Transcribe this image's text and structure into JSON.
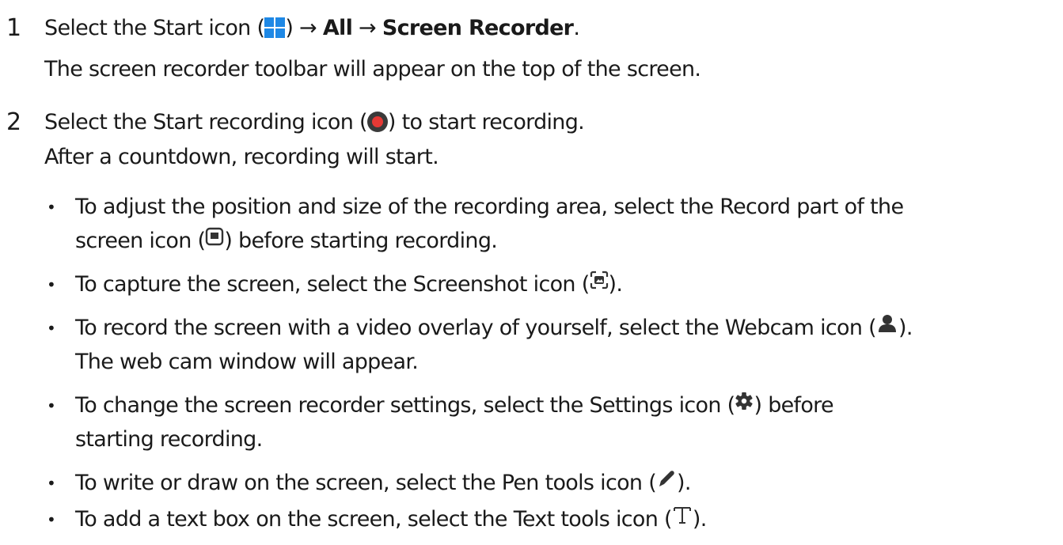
{
  "steps": [
    {
      "number": "1",
      "text_before": "Select the Start icon (",
      "text_mid1": ") → ",
      "bold1": "All",
      "arrow": " → ",
      "bold2": "Screen Recorder",
      "text_end": ".",
      "sub": "The screen recorder toolbar will appear on the top of the screen."
    },
    {
      "number": "2",
      "text_before": "Select the Start recording icon (",
      "text_after": ") to start recording.",
      "sub": "After a countdown, recording will start."
    }
  ],
  "bullets": [
    {
      "before": "To adjust the position and size of the recording area, select the Record part of the",
      "line2_before": "screen icon (",
      "line2_after": ") before starting recording.",
      "icon": "record-part-icon"
    },
    {
      "before": "To capture the screen, select the Screenshot icon (",
      "after": ").",
      "icon": "screenshot-icon"
    },
    {
      "before": "To record the screen with a video overlay of yourself, select the Webcam icon (",
      "after": ").",
      "line2": "The web cam window will appear.",
      "icon": "webcam-icon"
    },
    {
      "before": "To change the screen recorder settings, select the Settings icon (",
      "after": ") before",
      "line2": "starting recording.",
      "icon": "gear-icon"
    },
    {
      "before": "To write or draw on the screen, select the Pen tools icon (",
      "after": ").",
      "icon": "pen-icon"
    },
    {
      "before": "To add a text box on the screen, select the Text tools icon (",
      "after": ").",
      "icon": "text-tool-icon"
    }
  ],
  "bullet_symbol": "•",
  "colors": {
    "text": "#1a1a1a",
    "windows_blue": "#1e88e5",
    "record_red": "#e53935",
    "icon_dark": "#3a3a3a"
  }
}
